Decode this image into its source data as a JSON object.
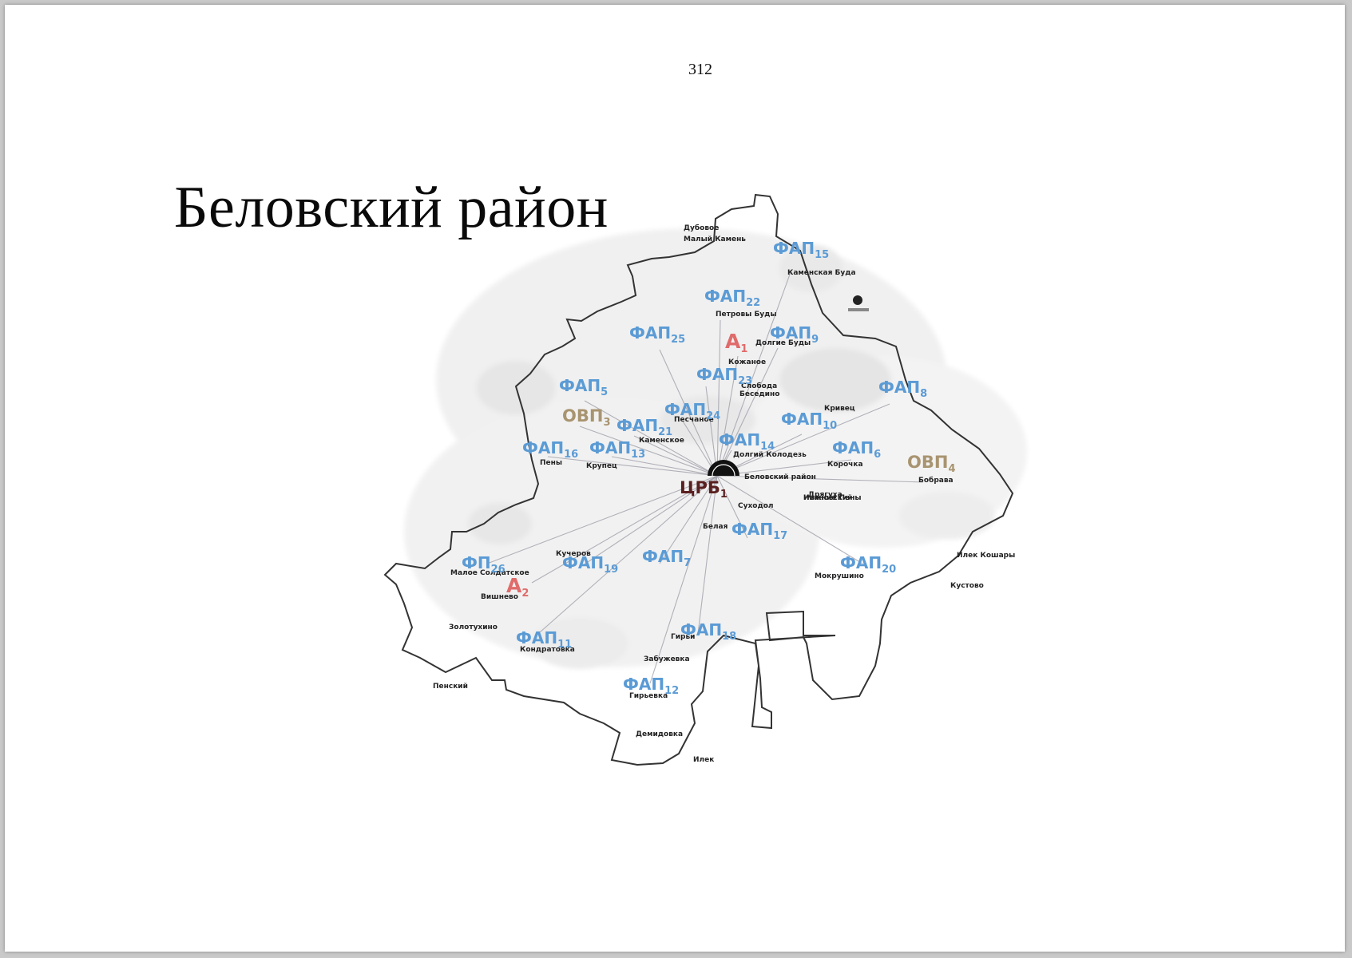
{
  "page": {
    "number": "312",
    "title": "Беловский район"
  },
  "map": {
    "colors": {
      "fap": "#5b9bd5",
      "ovp": "#a89470",
      "ambulatory": "#e06b6b",
      "crb": "#5a1f1f",
      "border": "#333333",
      "links": "#9a9aa6"
    },
    "hub": {
      "base": "ЦРБ",
      "sub": "1",
      "place": "Беловский район"
    },
    "facilities": [
      {
        "base": "ФАП",
        "sub": "15",
        "kind": "fap"
      },
      {
        "base": "ФАП",
        "sub": "22",
        "kind": "fap"
      },
      {
        "base": "ФАП",
        "sub": "25",
        "kind": "fap"
      },
      {
        "base": "А",
        "sub": "1",
        "kind": "amb"
      },
      {
        "base": "ФАП",
        "sub": "9",
        "kind": "fap"
      },
      {
        "base": "ФАП",
        "sub": "23",
        "kind": "fap"
      },
      {
        "base": "ФАП",
        "sub": "5",
        "kind": "fap"
      },
      {
        "base": "ОВП",
        "sub": "3",
        "kind": "ovp"
      },
      {
        "base": "ФАП",
        "sub": "24",
        "kind": "fap"
      },
      {
        "base": "ФАП",
        "sub": "8",
        "kind": "fap"
      },
      {
        "base": "ФАП",
        "sub": "21",
        "kind": "fap"
      },
      {
        "base": "ФАП",
        "sub": "10",
        "kind": "fap"
      },
      {
        "base": "ФАП",
        "sub": "16",
        "kind": "fap"
      },
      {
        "base": "ФАП",
        "sub": "13",
        "kind": "fap"
      },
      {
        "base": "ФАП",
        "sub": "14",
        "kind": "fap"
      },
      {
        "base": "ФАП",
        "sub": "6",
        "kind": "fap"
      },
      {
        "base": "ОВП",
        "sub": "4",
        "kind": "ovp"
      },
      {
        "base": "ФАП",
        "sub": "17",
        "kind": "fap"
      },
      {
        "base": "ФП",
        "sub": "26",
        "kind": "fap"
      },
      {
        "base": "ФАП",
        "sub": "19",
        "kind": "fap"
      },
      {
        "base": "ФАП",
        "sub": "7",
        "kind": "fap"
      },
      {
        "base": "ФАП",
        "sub": "20",
        "kind": "fap"
      },
      {
        "base": "А",
        "sub": "2",
        "kind": "amb"
      },
      {
        "base": "ФАП",
        "sub": "11",
        "kind": "fap"
      },
      {
        "base": "ФАП",
        "sub": "18",
        "kind": "fap"
      },
      {
        "base": "ФАП",
        "sub": "12",
        "kind": "fap"
      }
    ],
    "villages": [
      "Дубовое",
      "Малый Камень",
      "Каменская Буда",
      "Петровы Буды",
      "Долгие Буды",
      "Кожаное",
      "Слобода",
      "Беседино",
      "Кривец",
      "Долгий Колодезь",
      "Корочка",
      "Бобрава",
      "Пены",
      "Крупец",
      "Каменское",
      "Песчаное",
      "Суходол",
      "Белая",
      "Малое Солдатское",
      "Вишнево",
      "Кучеров",
      "Кондратовка",
      "Гирьи",
      "Забужевка",
      "Мокрушино",
      "Золотухино",
      "Пенский",
      "Гирьевка",
      "Демидовка",
      "Илек",
      "Илек Кошары",
      "Кустово",
      "Дрягуха",
      "Нижние Пены",
      "Ивановский"
    ]
  }
}
